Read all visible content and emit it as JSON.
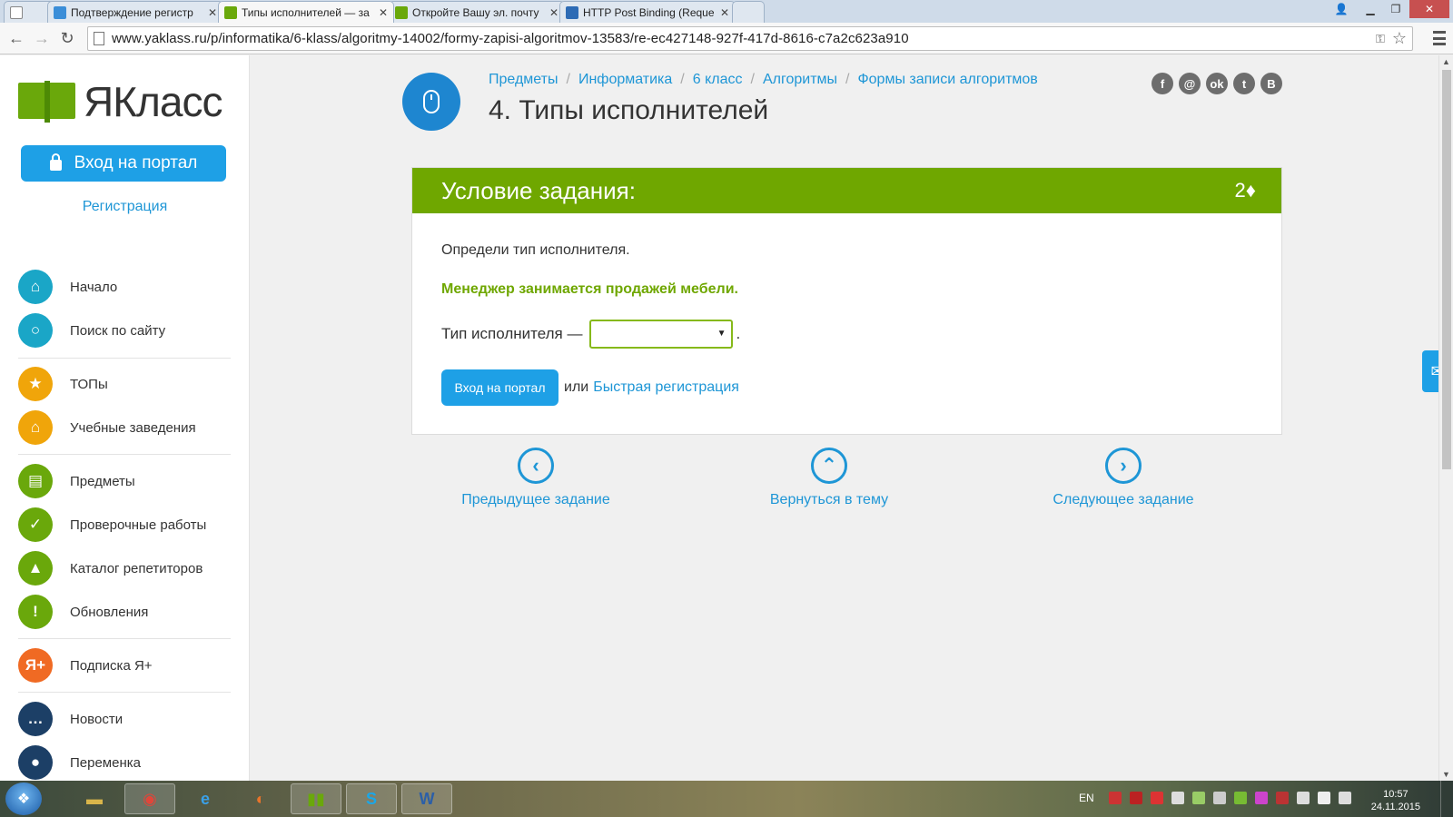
{
  "browser": {
    "tabs": [
      {
        "title": "",
        "kind": "blank"
      },
      {
        "title": "Подтверждение регистр",
        "favicon_color": "#3b8ed8"
      },
      {
        "title": "Типы исполнителей — за",
        "favicon_color": "#6aa80b"
      },
      {
        "title": "Откройте Вашу эл. почту",
        "favicon_color": "#6aa80b"
      },
      {
        "title": "HTTP Post Binding (Reque",
        "favicon_color": "#2d6bb5"
      },
      {
        "title": "",
        "kind": "new-tab"
      }
    ],
    "url": "www.yaklass.ru/p/informatika/6-klass/algoritmy-14002/formy-zapisi-algoritmov-13583/re-ec427148-927f-417d-8616-c7a2c623a910"
  },
  "sidebar": {
    "logo_text": "ЯКласс",
    "login_button": "Вход на портал",
    "register_link": "Регистрация",
    "items": [
      {
        "label": "Начало",
        "icon": "home-icon",
        "color": "#1aa6c7",
        "glyph": "⌂"
      },
      {
        "label": "Поиск по сайту",
        "icon": "search-icon",
        "color": "#1aa6c7",
        "glyph": "○"
      },
      {
        "label": "ТОПы",
        "icon": "star-icon",
        "color": "#f0a50a",
        "glyph": "★"
      },
      {
        "label": "Учебные заведения",
        "icon": "institution-icon",
        "color": "#f0a50a",
        "glyph": "⌂"
      },
      {
        "label": "Предметы",
        "icon": "book-icon",
        "color": "#6aa80b",
        "glyph": "▤"
      },
      {
        "label": "Проверочные работы",
        "icon": "check-icon",
        "color": "#6aa80b",
        "glyph": "✓"
      },
      {
        "label": "Каталог репетиторов",
        "icon": "graduation-cap-icon",
        "color": "#6aa80b",
        "glyph": "▲"
      },
      {
        "label": "Обновления",
        "icon": "exclamation-icon",
        "color": "#6aa80b",
        "glyph": "!"
      },
      {
        "label": "Подписка Я+",
        "icon": "subscription-icon",
        "color": "#f06a23",
        "glyph": "Я+"
      },
      {
        "label": "Новости",
        "icon": "news-icon",
        "color": "#1c3f66",
        "glyph": "…"
      },
      {
        "label": "Переменка",
        "icon": "break-icon",
        "color": "#1c3f66",
        "glyph": "●"
      }
    ]
  },
  "header": {
    "breadcrumbs": [
      "Предметы",
      "Информатика",
      "6 класс",
      "Алгоритмы",
      "Формы записи алгоритмов"
    ],
    "title": "4. Типы исполнителей",
    "socials": [
      {
        "glyph": "f",
        "icon": "facebook-icon"
      },
      {
        "glyph": "@",
        "icon": "mail-ru-icon"
      },
      {
        "glyph": "ok",
        "icon": "odnoklassniki-icon"
      },
      {
        "glyph": "t",
        "icon": "twitter-icon"
      },
      {
        "glyph": "В",
        "icon": "vkontakte-icon"
      }
    ]
  },
  "task": {
    "heading": "Условие задания:",
    "points": "2♦",
    "instruction": "Определи тип исполнителя.",
    "statement": "Менеджер занимается продажей мебели.",
    "answer_label": "Тип исполнителя —",
    "answer_value": "",
    "answer_suffix": ".",
    "login_button": "Вход на портал",
    "or_text": "или",
    "quick_register": "Быстрая регистрация"
  },
  "task_nav": {
    "prev": "Предыдущее задание",
    "back": "Вернуться в тему",
    "next": "Следующее задание"
  },
  "taskbar": {
    "language": "EN",
    "time": "10:57",
    "date": "24.11.2015",
    "apps": [
      {
        "name": "explorer",
        "glyph": "▬",
        "color": "#d9b54a"
      },
      {
        "name": "chrome",
        "glyph": "◉",
        "color": "#e0463a",
        "active": true
      },
      {
        "name": "internet-explorer",
        "glyph": "e",
        "color": "#3aa0e8"
      },
      {
        "name": "firefox",
        "glyph": "◐",
        "color": "#e8742a"
      },
      {
        "name": "yaklass",
        "glyph": "▮▮",
        "color": "#6aa80b",
        "active": true
      },
      {
        "name": "skype",
        "glyph": "S",
        "color": "#1aa7e8",
        "active": true
      },
      {
        "name": "word",
        "glyph": "W",
        "color": "#2b5fa8",
        "active": true
      }
    ]
  }
}
